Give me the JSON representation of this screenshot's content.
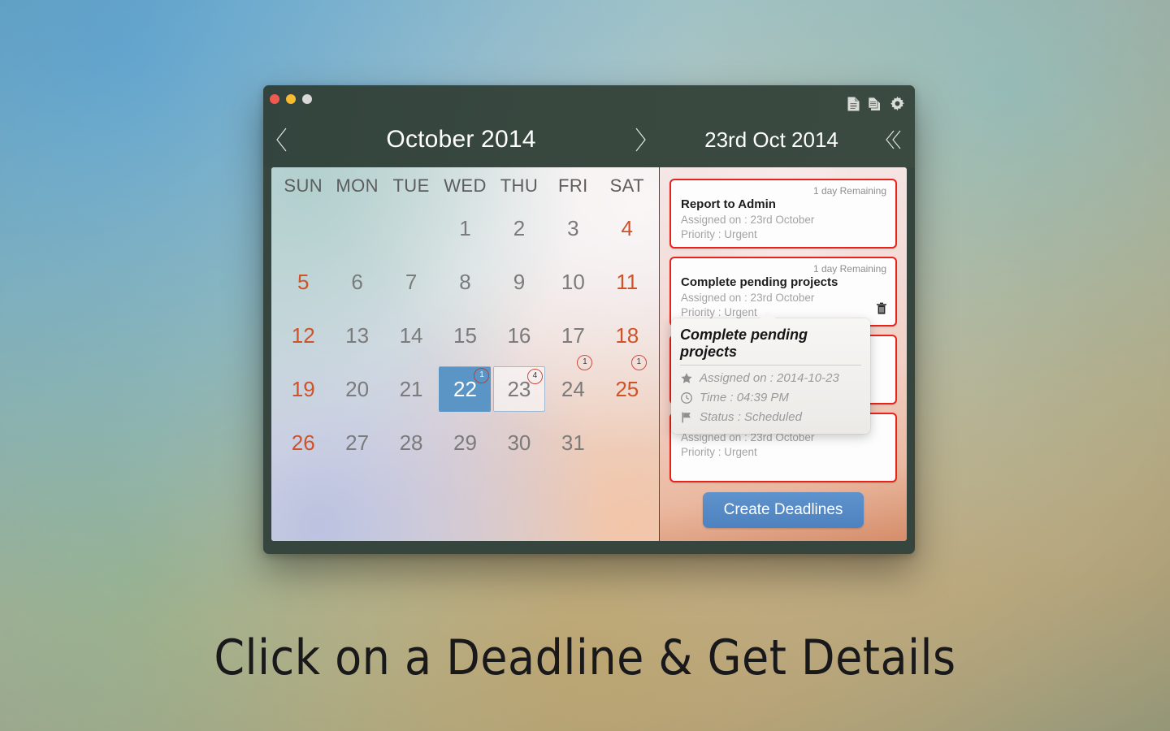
{
  "window": {
    "traffic_lights": [
      "close",
      "minimize",
      "zoom"
    ],
    "tools": [
      "document-icon",
      "documents-stack-icon",
      "gear-icon"
    ],
    "accent_blue": "#5b95c5",
    "accent_red": "#e8231a",
    "weekend_color": "#cf5228",
    "titlebar_color": "#36463f"
  },
  "calendar": {
    "month_title": "October 2014",
    "prev_label": "‹",
    "next_label": "›",
    "weekdays": [
      "SUN",
      "MON",
      "TUE",
      "WED",
      "THU",
      "FRI",
      "SAT"
    ],
    "weeks": [
      [
        {
          "num": "",
          "empty": true
        },
        {
          "num": "",
          "empty": true
        },
        {
          "num": "",
          "empty": true
        },
        {
          "num": "1"
        },
        {
          "num": "2"
        },
        {
          "num": "3"
        },
        {
          "num": "4",
          "weekend": true
        }
      ],
      [
        {
          "num": "5",
          "weekend": true
        },
        {
          "num": "6"
        },
        {
          "num": "7"
        },
        {
          "num": "8"
        },
        {
          "num": "9"
        },
        {
          "num": "10"
        },
        {
          "num": "11",
          "weekend": true
        }
      ],
      [
        {
          "num": "12",
          "weekend": true
        },
        {
          "num": "13"
        },
        {
          "num": "14"
        },
        {
          "num": "15"
        },
        {
          "num": "16"
        },
        {
          "num": "17"
        },
        {
          "num": "18",
          "weekend": true
        }
      ],
      [
        {
          "num": "19",
          "weekend": true
        },
        {
          "num": "20"
        },
        {
          "num": "21"
        },
        {
          "num": "22",
          "selected": true,
          "badge": "1"
        },
        {
          "num": "23",
          "focused": true,
          "badge": "4"
        },
        {
          "num": "24",
          "badge": "1",
          "freeBadge": true
        },
        {
          "num": "25",
          "weekend": true,
          "badge": "1",
          "freeBadge": true
        }
      ],
      [
        {
          "num": "26",
          "weekend": true
        },
        {
          "num": "27"
        },
        {
          "num": "28"
        },
        {
          "num": "29"
        },
        {
          "num": "30"
        },
        {
          "num": "31"
        },
        {
          "num": "",
          "empty": true
        }
      ]
    ]
  },
  "detail": {
    "day_title": "23rd Oct 2014",
    "collapse_label": "«",
    "create_button": "Create Deadlines",
    "cards": [
      {
        "remaining": "1 day Remaining",
        "title": "Report to Admin",
        "assigned": "Assigned on : 23rd October",
        "priority": "Priority : Urgent",
        "has_trash": false
      },
      {
        "remaining": "1 day Remaining",
        "title": "Complete pending projects",
        "assigned": "Assigned on : 23rd October",
        "priority": "Priority : Urgent",
        "has_trash": true
      },
      {
        "remaining": "",
        "title": "",
        "assigned": "",
        "priority": "",
        "has_trash": false
      },
      {
        "remaining": "",
        "title": "",
        "assigned": "Assigned on : 23rd October",
        "priority": "Priority : Urgent",
        "has_trash": false
      }
    ],
    "popover": {
      "title": "Complete pending projects",
      "rows": [
        {
          "icon": "star-icon",
          "text": "Assigned on : 2014-10-23"
        },
        {
          "icon": "clock-icon",
          "text": "Time : 04:39 PM"
        },
        {
          "icon": "flag-icon",
          "text": "Status : Scheduled"
        }
      ]
    }
  },
  "caption": "Click on a Deadline & Get Details"
}
